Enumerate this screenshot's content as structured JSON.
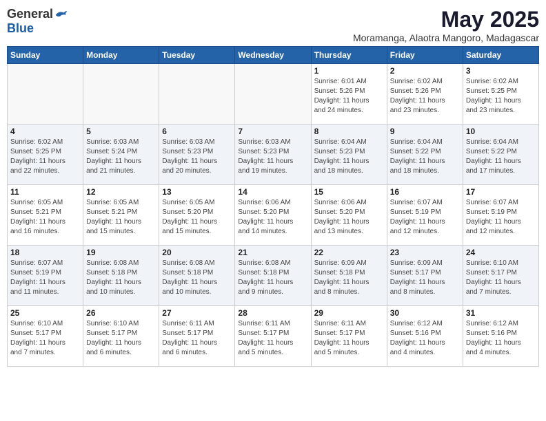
{
  "header": {
    "logo_general": "General",
    "logo_blue": "Blue",
    "month_title": "May 2025",
    "location": "Moramanga, Alaotra Mangoro, Madagascar"
  },
  "weekdays": [
    "Sunday",
    "Monday",
    "Tuesday",
    "Wednesday",
    "Thursday",
    "Friday",
    "Saturday"
  ],
  "weeks": [
    [
      {
        "day": "",
        "info": ""
      },
      {
        "day": "",
        "info": ""
      },
      {
        "day": "",
        "info": ""
      },
      {
        "day": "",
        "info": ""
      },
      {
        "day": "1",
        "info": "Sunrise: 6:01 AM\nSunset: 5:26 PM\nDaylight: 11 hours\nand 24 minutes."
      },
      {
        "day": "2",
        "info": "Sunrise: 6:02 AM\nSunset: 5:26 PM\nDaylight: 11 hours\nand 23 minutes."
      },
      {
        "day": "3",
        "info": "Sunrise: 6:02 AM\nSunset: 5:25 PM\nDaylight: 11 hours\nand 23 minutes."
      }
    ],
    [
      {
        "day": "4",
        "info": "Sunrise: 6:02 AM\nSunset: 5:25 PM\nDaylight: 11 hours\nand 22 minutes."
      },
      {
        "day": "5",
        "info": "Sunrise: 6:03 AM\nSunset: 5:24 PM\nDaylight: 11 hours\nand 21 minutes."
      },
      {
        "day": "6",
        "info": "Sunrise: 6:03 AM\nSunset: 5:23 PM\nDaylight: 11 hours\nand 20 minutes."
      },
      {
        "day": "7",
        "info": "Sunrise: 6:03 AM\nSunset: 5:23 PM\nDaylight: 11 hours\nand 19 minutes."
      },
      {
        "day": "8",
        "info": "Sunrise: 6:04 AM\nSunset: 5:23 PM\nDaylight: 11 hours\nand 18 minutes."
      },
      {
        "day": "9",
        "info": "Sunrise: 6:04 AM\nSunset: 5:22 PM\nDaylight: 11 hours\nand 18 minutes."
      },
      {
        "day": "10",
        "info": "Sunrise: 6:04 AM\nSunset: 5:22 PM\nDaylight: 11 hours\nand 17 minutes."
      }
    ],
    [
      {
        "day": "11",
        "info": "Sunrise: 6:05 AM\nSunset: 5:21 PM\nDaylight: 11 hours\nand 16 minutes."
      },
      {
        "day": "12",
        "info": "Sunrise: 6:05 AM\nSunset: 5:21 PM\nDaylight: 11 hours\nand 15 minutes."
      },
      {
        "day": "13",
        "info": "Sunrise: 6:05 AM\nSunset: 5:20 PM\nDaylight: 11 hours\nand 15 minutes."
      },
      {
        "day": "14",
        "info": "Sunrise: 6:06 AM\nSunset: 5:20 PM\nDaylight: 11 hours\nand 14 minutes."
      },
      {
        "day": "15",
        "info": "Sunrise: 6:06 AM\nSunset: 5:20 PM\nDaylight: 11 hours\nand 13 minutes."
      },
      {
        "day": "16",
        "info": "Sunrise: 6:07 AM\nSunset: 5:19 PM\nDaylight: 11 hours\nand 12 minutes."
      },
      {
        "day": "17",
        "info": "Sunrise: 6:07 AM\nSunset: 5:19 PM\nDaylight: 11 hours\nand 12 minutes."
      }
    ],
    [
      {
        "day": "18",
        "info": "Sunrise: 6:07 AM\nSunset: 5:19 PM\nDaylight: 11 hours\nand 11 minutes."
      },
      {
        "day": "19",
        "info": "Sunrise: 6:08 AM\nSunset: 5:18 PM\nDaylight: 11 hours\nand 10 minutes."
      },
      {
        "day": "20",
        "info": "Sunrise: 6:08 AM\nSunset: 5:18 PM\nDaylight: 11 hours\nand 10 minutes."
      },
      {
        "day": "21",
        "info": "Sunrise: 6:08 AM\nSunset: 5:18 PM\nDaylight: 11 hours\nand 9 minutes."
      },
      {
        "day": "22",
        "info": "Sunrise: 6:09 AM\nSunset: 5:18 PM\nDaylight: 11 hours\nand 8 minutes."
      },
      {
        "day": "23",
        "info": "Sunrise: 6:09 AM\nSunset: 5:17 PM\nDaylight: 11 hours\nand 8 minutes."
      },
      {
        "day": "24",
        "info": "Sunrise: 6:10 AM\nSunset: 5:17 PM\nDaylight: 11 hours\nand 7 minutes."
      }
    ],
    [
      {
        "day": "25",
        "info": "Sunrise: 6:10 AM\nSunset: 5:17 PM\nDaylight: 11 hours\nand 7 minutes."
      },
      {
        "day": "26",
        "info": "Sunrise: 6:10 AM\nSunset: 5:17 PM\nDaylight: 11 hours\nand 6 minutes."
      },
      {
        "day": "27",
        "info": "Sunrise: 6:11 AM\nSunset: 5:17 PM\nDaylight: 11 hours\nand 6 minutes."
      },
      {
        "day": "28",
        "info": "Sunrise: 6:11 AM\nSunset: 5:17 PM\nDaylight: 11 hours\nand 5 minutes."
      },
      {
        "day": "29",
        "info": "Sunrise: 6:11 AM\nSunset: 5:17 PM\nDaylight: 11 hours\nand 5 minutes."
      },
      {
        "day": "30",
        "info": "Sunrise: 6:12 AM\nSunset: 5:16 PM\nDaylight: 11 hours\nand 4 minutes."
      },
      {
        "day": "31",
        "info": "Sunrise: 6:12 AM\nSunset: 5:16 PM\nDaylight: 11 hours\nand 4 minutes."
      }
    ]
  ]
}
